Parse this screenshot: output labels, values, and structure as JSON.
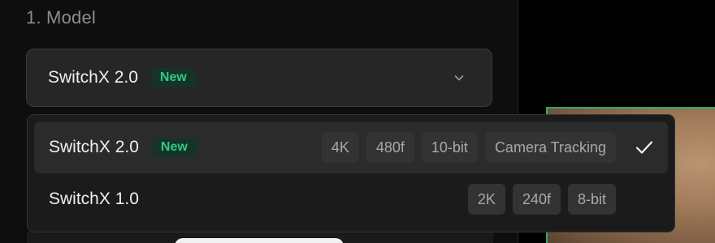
{
  "section": {
    "title": "1. Model"
  },
  "select": {
    "value": "SwitchX 2.0",
    "badge": "New",
    "icon": "chevron-down-icon"
  },
  "dropdown": {
    "options": [
      {
        "name": "SwitchX 2.0",
        "badge": "New",
        "tags": [
          "4K",
          "480f",
          "10-bit",
          "Camera Tracking"
        ],
        "selected": true
      },
      {
        "name": "SwitchX 1.0",
        "tags": [
          "2K",
          "240f",
          "8-bit"
        ],
        "selected": false
      }
    ]
  },
  "colors": {
    "accent_green": "#34c785",
    "preview_border": "#2fa86b"
  }
}
